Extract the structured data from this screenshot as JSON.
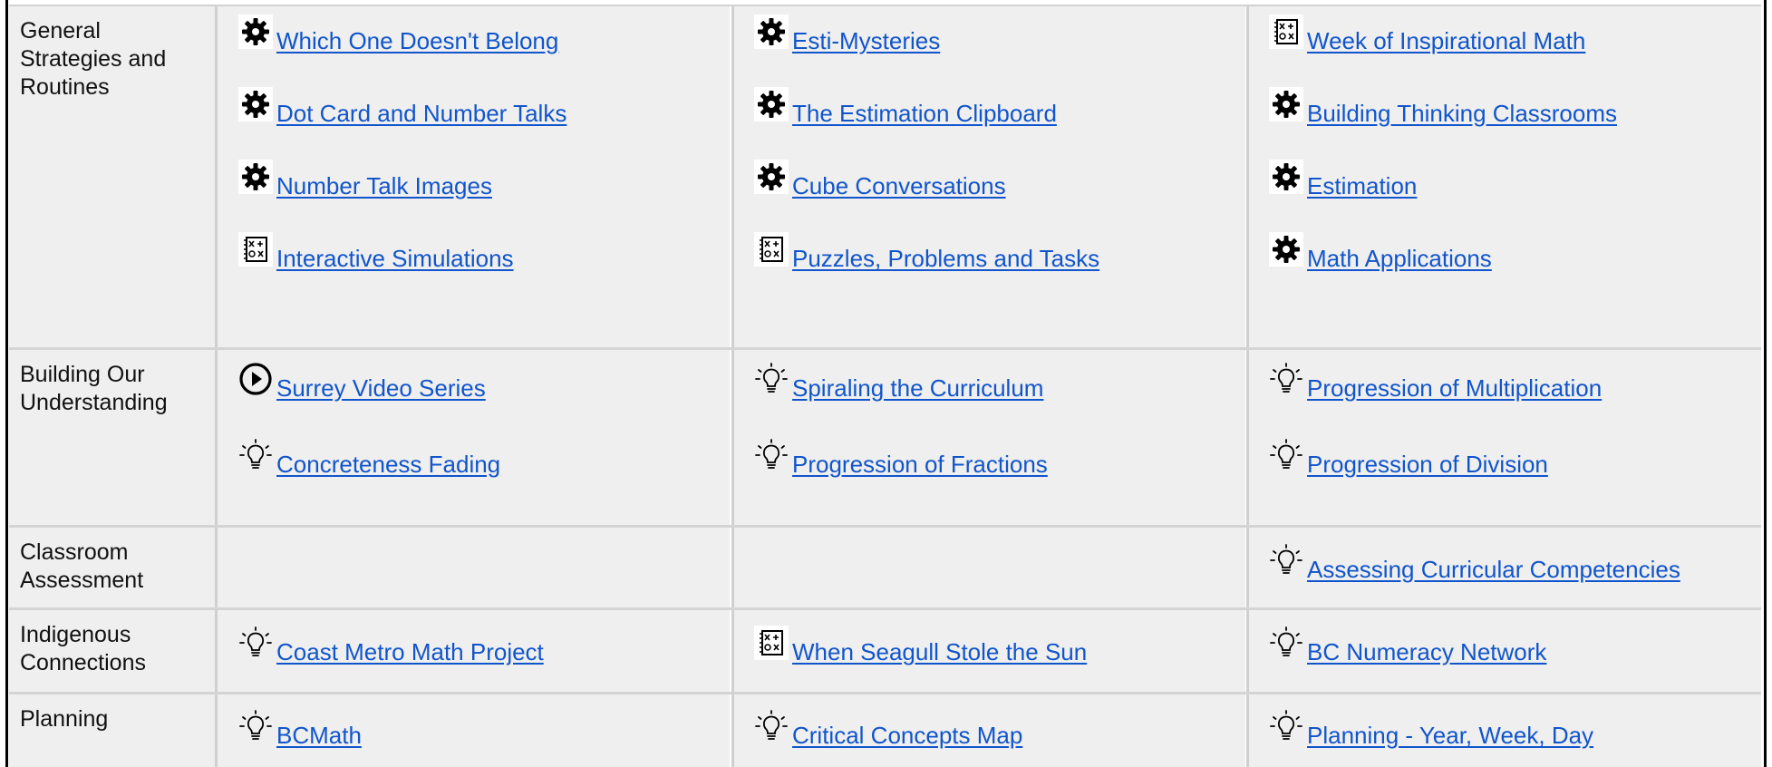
{
  "rows": [
    {
      "label": "General\nStrategies and\nRoutines",
      "links": [
        {
          "text": "Which One Doesn't Belong",
          "icon": "gear-icon"
        },
        {
          "text": "Esti-Mysteries",
          "icon": "gear-icon"
        },
        {
          "text": "Week of Inspirational Math",
          "icon": "math-sheet-icon"
        },
        {
          "text": "Dot Card and Number Talks",
          "icon": "gear-icon"
        },
        {
          "text": "The Estimation Clipboard",
          "icon": "gear-icon"
        },
        {
          "text": "Building Thinking Classrooms",
          "icon": "gear-icon"
        },
        {
          "text": "Number Talk Images",
          "icon": "gear-icon"
        },
        {
          "text": "Cube Conversations",
          "icon": "gear-icon"
        },
        {
          "text": "Estimation",
          "icon": "gear-icon"
        },
        {
          "text": "Interactive Simulations",
          "icon": "math-sheet-icon"
        },
        {
          "text": "Puzzles, Problems and Tasks",
          "icon": "math-sheet-icon"
        },
        {
          "text": "Math Applications",
          "icon": "gear-icon"
        }
      ]
    },
    {
      "label": "Building Our\nUnderstanding",
      "links": [
        {
          "text": "Surrey Video Series",
          "icon": "play-icon"
        },
        {
          "text": "Spiraling the Curriculum",
          "icon": "lightbulb-icon"
        },
        {
          "text": "Progression of Multiplication",
          "icon": "lightbulb-icon"
        },
        {
          "text": "Concreteness Fading",
          "icon": "lightbulb-icon"
        },
        {
          "text": "Progression of Fractions",
          "icon": "lightbulb-icon"
        },
        {
          "text": "Progression of Division",
          "icon": "lightbulb-icon"
        }
      ]
    },
    {
      "label": "Classroom\nAssessment",
      "links": [
        {
          "text": "Assessing Curricular Competencies",
          "icon": "lightbulb-icon"
        }
      ]
    },
    {
      "label": "Indigenous\nConnections",
      "links": [
        {
          "text": "Coast Metro Math Project",
          "icon": "lightbulb-icon"
        },
        {
          "text": "When Seagull Stole the Sun",
          "icon": "math-sheet-icon"
        },
        {
          "text": "BC Numeracy Network",
          "icon": "lightbulb-icon"
        }
      ]
    },
    {
      "label": "Planning",
      "links": [
        {
          "text": "BCMath",
          "icon": "lightbulb-icon"
        },
        {
          "text": "Critical Concepts Map",
          "icon": "lightbulb-icon"
        },
        {
          "text": "Planning - Year, Week, Day",
          "icon": "lightbulb-icon"
        }
      ]
    }
  ]
}
